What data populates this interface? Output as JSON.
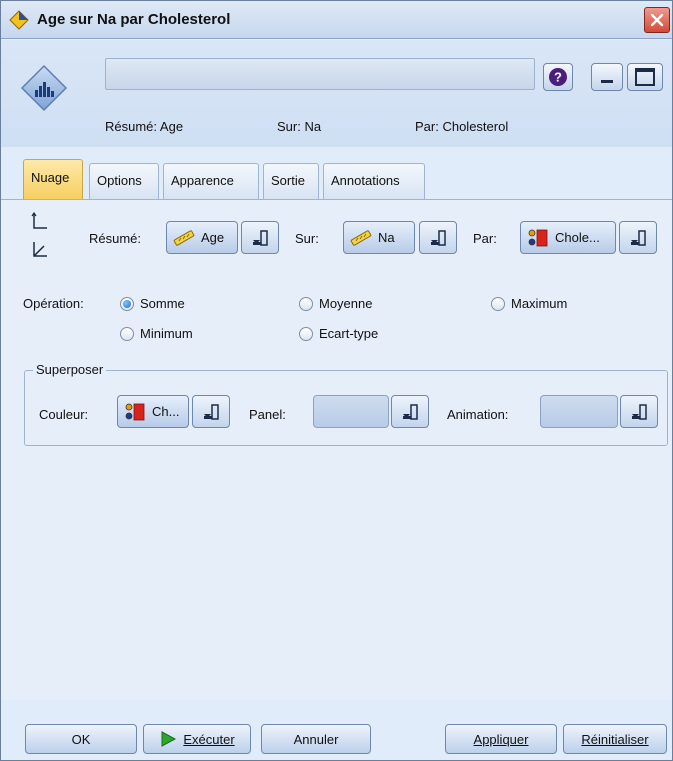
{
  "window": {
    "title": "Age sur Na par Cholesterol"
  },
  "header": {
    "summary_label": "Résumé: Age",
    "over_label": "Sur: Na",
    "by_label": "Par: Cholesterol",
    "help_glyph": "?"
  },
  "tabs": [
    {
      "label": "Nuage",
      "active": true
    },
    {
      "label": "Options",
      "active": false
    },
    {
      "label": "Apparence",
      "active": false
    },
    {
      "label": "Sortie",
      "active": false
    },
    {
      "label": "Annotations",
      "active": false
    }
  ],
  "fields": {
    "resume_label": "Résumé:",
    "resume_value": "Age",
    "sur_label": "Sur:",
    "sur_value": "Na",
    "par_label": "Par:",
    "par_value": "Chole..."
  },
  "operation": {
    "label": "Opération:",
    "options": [
      "Somme",
      "Moyenne",
      "Maximum",
      "Minimum",
      "Ecart-type"
    ],
    "selected": "Somme"
  },
  "overlay": {
    "title": "Superposer",
    "couleur_label": "Couleur:",
    "couleur_value": "Ch...",
    "panel_label": "Panel:",
    "animation_label": "Animation:"
  },
  "buttons": {
    "ok": "OK",
    "execute": "Exécuter",
    "cancel": "Annuler",
    "apply": "Appliquer",
    "reset": "Réinitialiser"
  },
  "colors": {
    "active_tab": "#f6cf60",
    "panel_bg": "#e6eefa",
    "close_button": "#d24a37"
  }
}
